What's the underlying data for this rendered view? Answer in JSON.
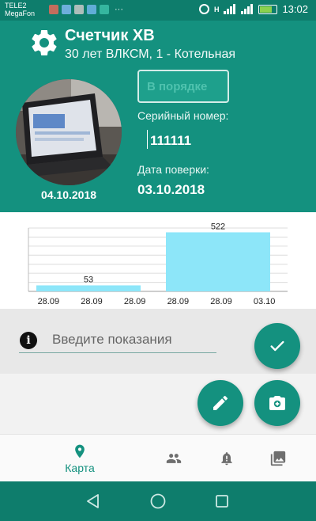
{
  "status_bar": {
    "carrier_line1": "TELE2",
    "carrier_line2": "MegaFon",
    "more": "···",
    "network": "H",
    "time": "13:02"
  },
  "app_bar": {
    "title": "Счетчик ХВ",
    "subtitle": "30 лет ВЛКСМ, 1 - Котельная",
    "icon": "gear-icon"
  },
  "meter": {
    "photo_date": "04.10.2018",
    "status": "В порядке",
    "serial_label": "Серийный номер:",
    "serial_value": "111111",
    "verification_label": "Дата поверки:",
    "verification_value": "03.10.2018"
  },
  "chart_data": {
    "type": "bar",
    "categories": [
      "28.09",
      "28.09",
      "28.09",
      "28.09",
      "28.09",
      "03.10"
    ],
    "values": [
      53,
      522
    ],
    "bars": [
      {
        "label": "53",
        "value": 53
      },
      {
        "label": "522",
        "value": 522
      }
    ],
    "bar_color": "#8de6f9",
    "grid": true
  },
  "reading": {
    "placeholder": "Введите показания",
    "value": ""
  },
  "fabs": {
    "confirm_icon": "check-icon",
    "edit_icon": "pencil-icon",
    "photo_icon": "camera-icon"
  },
  "bottom_nav": {
    "items": [
      {
        "label": "Карта",
        "icon": "map-pin-icon",
        "active": true
      },
      {
        "label": "",
        "icon": "people-icon",
        "active": false
      },
      {
        "label": "",
        "icon": "alert-icon",
        "active": false
      },
      {
        "label": "",
        "icon": "gallery-icon",
        "active": false
      }
    ]
  },
  "colors": {
    "primary": "#14917f",
    "primary_dark": "#0e7d6c",
    "bar": "#8de6f9"
  }
}
